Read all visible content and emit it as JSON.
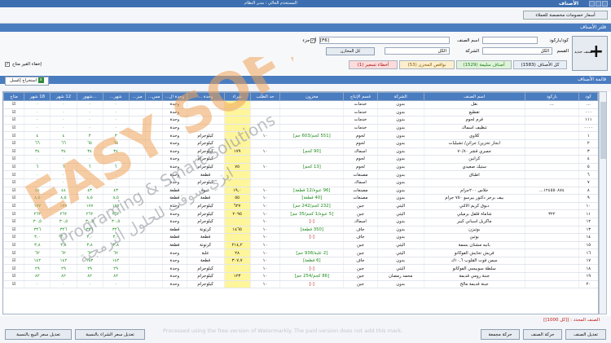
{
  "window": {
    "title": "الأصناف",
    "subtitle": "المستخدم الحالي : مدير النظام"
  },
  "customer_prices_button": "أسعار خصومات مخصصة للعملاء",
  "filter": {
    "header": "فلتر الأصناف",
    "barcode_label": "كود/باركود",
    "name_label": "اسم الصنف",
    "any_part_label": "أي جزء",
    "f6_label": "[F6]",
    "section_label": "القسم",
    "section_value": "الكل",
    "company_label": "الشركة",
    "company_value": "الكل",
    "all_stores_button": "كل المخازن",
    "new_item_button": "صنف جديد",
    "hide_unavailable_label": "إخفاء الغير متاح",
    "chips": {
      "all_items": "كل الأصناف (1583)",
      "valid_items": "أصناف سليمة (1529)",
      "store_shortages": "نواقص المخزن (53)",
      "pricing_errors": "أخطاء تسعير (1)"
    }
  },
  "results": {
    "header": "قائمة الأصناف",
    "export_label": "استخراج إكسيل"
  },
  "table": {
    "columns": [
      "كود",
      "باركود",
      "اسم الصنف",
      "الشركة",
      "قسم الإنتاج",
      "مخزون",
      "حد الطلب",
      "شراء",
      "وحدة ...",
      "وحدة ال...",
      "مس...",
      "ميز...",
      "شهر...",
      "...شهور",
      "12 شهر",
      "18 شهر",
      "متاح"
    ],
    "rows": [
      [
        "...",
        "...",
        "نقل",
        "بدون",
        "خدمات",
        "",
        "",
        "",
        "",
        "وحدة",
        "",
        "",
        "٠",
        "٠",
        "٠",
        "٠",
        "☑"
      ],
      [
        "٠٠٠",
        "",
        "تقطيع",
        "بدون",
        "خدمات",
        "",
        "",
        "",
        "",
        "وحدة",
        "",
        "",
        "٠",
        "٠",
        "٠",
        "٠",
        "☑"
      ],
      [
        "١١١",
        "",
        "قرم لحوم",
        "بدون",
        "خدمات",
        "",
        "",
        "",
        "",
        "وحدة",
        "",
        "",
        "٠",
        "٠",
        "٠",
        "٠",
        "☑"
      ],
      [
        "٠٠٠٠",
        "",
        "تنظيف اسماك",
        "بدون",
        "خدمات",
        "",
        "",
        "",
        "",
        "وحدة",
        "",
        "",
        "٠",
        "٠",
        "٠",
        "٠",
        "☑"
      ],
      [
        "١",
        "",
        "كلاوي",
        "بدون",
        "لحوم",
        "[551 كجم/603 جم]",
        "١٠",
        "",
        "كيلوجرام",
        "وحدة",
        "",
        "",
        "٣",
        "٣",
        "٤",
        "٤",
        "☑"
      ],
      [
        "٢",
        "",
        "ابجار تخزين/ جرائن/ تشيليات",
        "بدون",
        "لحوم",
        "",
        "",
        "",
        "كيلوجرام",
        "وحدة",
        "",
        "",
        "٦٥",
        "٦٥",
        "٦٦",
        "٦٦",
        "☑"
      ],
      [
        "٣",
        "",
        "جمبري قشر ٧٠/٨٠",
        "بدون",
        "اسماك",
        "[90 كجم]",
        "١٠",
        "١٧٩",
        "كيلوجرام",
        "وحدة",
        "",
        "",
        "٣٤",
        "٣٤",
        "٣٤",
        "٣٤",
        "☑"
      ],
      [
        "٤",
        "",
        "كرانين",
        "بدون",
        "لحوم",
        "",
        "",
        "",
        "كيلوجرام",
        "وحدة",
        "",
        "",
        "٠",
        "٠",
        "٠",
        "٠",
        "☑"
      ],
      [
        "٥",
        "",
        "ستيك صعيدي",
        "بدون",
        "لحوم",
        "[13 كجم]",
        "١٠",
        "٧٥",
        "كيلوجرام",
        "وحدة",
        "",
        "",
        "٦",
        "٦",
        "٦",
        "٦",
        "☑"
      ],
      [
        "٦",
        "",
        "اطباق",
        "بدون",
        "مصنعات",
        "",
        "",
        "",
        "قطعة",
        "وحدة",
        "",
        "",
        "٠",
        "٠",
        "٠",
        "٠",
        "☑"
      ],
      [
        "٧",
        "",
        "",
        "بدون",
        "اسماك",
        "",
        "",
        "",
        "كيلوجرام",
        "وحدة",
        "",
        "",
        "٠",
        "٠",
        "٠",
        "٠",
        "☑"
      ],
      [
        "٨",
        "١٢٤٥٥٠٨٧٤...",
        "جلاس ٢٠٠جرام",
        "بدون",
        "مصنعات",
        "[96 عبوة/12 قطعة]",
        "١٠",
        "١٩,٠",
        "عبوة",
        "قطعة",
        "",
        "",
        "٤٣",
        "٤٣",
        "٤٤",
        "٤٤",
        "☑"
      ],
      [
        "٩",
        "",
        "بيف برجر دكتور بيرسو ٧٥٠ جرام",
        "بدون",
        "مصنعات",
        "[40 قطعة]",
        "١٠",
        "٥٥",
        "قطعة",
        "قطعة",
        "",
        "",
        "٨,٥",
        "٨,٥",
        "٨,٥",
        "٨,٥",
        "☑"
      ],
      [
        "١٠",
        "",
        "دبوق كريم الالتي",
        "اليتي",
        "جبن",
        "[232 كجم/242 جم]",
        "١٠",
        "٦٢٧",
        "كيلوجرام",
        "وحدة",
        "",
        "",
        "١٧٧",
        "١٧٧",
        "١٧٧",
        "١٧٧",
        "☑"
      ],
      [
        "١١",
        "٣٢٢",
        "شاماة فلقل برميلي",
        "اليتي",
        "جبن",
        "[5 عبوة/1 كجم/35 جم]",
        "١٠",
        "٢٠٩٥",
        "كيلوجرام",
        "وحدة",
        "",
        "",
        "٢٦٢",
        "٢٦٢",
        "٢٦٢",
        "٢٦٢",
        "☑"
      ],
      [
        "١٢",
        "",
        "ماكريل اسباني كبير",
        "بدون",
        "اسماك",
        "[-]",
        "١٠",
        "",
        "كيلوجرام",
        "وحدة",
        "",
        "",
        "٣٠,٥",
        "٣٠,٥",
        "٣٠,٥",
        "٣٠,٥",
        "☑"
      ],
      [
        "١٣",
        "",
        "بوتيزن",
        "بدون",
        "جاف",
        "[350 قطعة]",
        "١٠",
        "١٤٦٥",
        "كرتونة",
        "قطعة",
        "",
        "",
        "٣٢٦",
        "٣٢٦",
        "٣٢٦",
        "٣٢٦",
        "☑"
      ],
      [
        "١٤",
        "",
        "يوتين",
        "بدون",
        "جاف",
        "[-]",
        "١٠",
        "",
        "قطعة",
        "قطعة",
        "",
        "",
        "٣,٠",
        "٣,٠",
        "٣,٠",
        "٣,٠",
        "☑"
      ],
      [
        "١٥",
        "",
        "بانيه مشتان بسمة",
        "اليتي",
        "جبن",
        "",
        "١٠",
        "٢١٤,٢",
        "كرتونة",
        "قطعة",
        "",
        "",
        "٣,٨",
        "٣,٨",
        "٣,٨",
        "٣,٨",
        "☑"
      ],
      [
        "١٦",
        "",
        "قريش تحايش الفوكانو",
        "اليتي",
        "جبن",
        "[2 علبة/938 جم]",
        "١٠",
        "٢٨",
        "علبة",
        "وحدة",
        "",
        "",
        "٦٢",
        "٦٢",
        "٦٢",
        "٦٢",
        "☑"
      ],
      [
        "١٧",
        "",
        "سمن قوت القلوب ١٠,٦ك",
        "بدون",
        "جاف",
        "[6 قطعة]",
        "١٠",
        "٣٠٧,٧",
        "قطعة",
        "وحدة",
        "",
        "",
        "١٤٢",
        "١٤٢",
        "١٤٢",
        "١٤٢",
        "☑"
      ],
      [
        "١٨",
        "",
        "سلطة سوبيسي الفوكانو",
        "اليتي",
        "جبن",
        "[-]",
        "١٠",
        "",
        "كيلوجرام",
        "وحدة",
        "",
        "",
        "٢٩",
        "٢٩",
        "٢٩",
        "٢٩",
        "☑"
      ],
      [
        "١٩",
        "",
        "جبنة رومي قديمة",
        "محمد رمضان",
        "جبن",
        "[86 كجم/254 جم]",
        "١٠",
        "١٢٣",
        "كيلوجرام",
        "وحدة",
        "",
        "",
        "٨٢",
        "٨٢",
        "٨٢",
        "٨٢",
        "☑"
      ],
      [
        "٢٠",
        "",
        "جبنة قديمة مالح",
        "بدون",
        "جبن",
        "[-]",
        "١٠",
        "",
        "كيلوجرام",
        "وحدة",
        "",
        "",
        "٠",
        "٠",
        "٠",
        "٠",
        "☑"
      ]
    ]
  },
  "status": {
    "selected_count": "الصنف المحدد : [[كل 1000]]"
  },
  "watermark": {
    "brand": "EASY SOFT",
    "tagline": "Programing & Smart Solutions",
    "arabic": "ايزي سوفت للحلول البرمجية",
    "note": "Processed using the free version of Watermarkly. The paid version does not add this mark."
  },
  "footer": {
    "edit_item": "تعديل الصنف",
    "item_movement": "حركة الصنف",
    "total_movement": "حركة مجمعة",
    "adjust_purchase": "تعديل سعر الشراء بالنسبة",
    "adjust_sale": "تعديل سعر البيع بالنسبة"
  }
}
